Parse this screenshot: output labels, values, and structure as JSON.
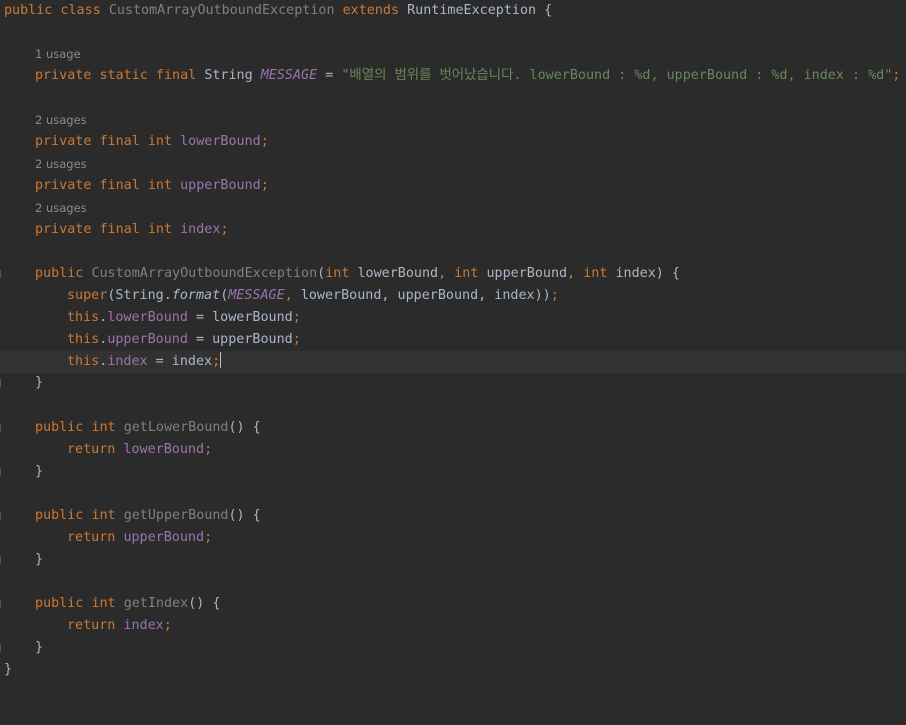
{
  "editor": {
    "inlay_hints": {
      "message": "1 usage",
      "lower": "2 usages",
      "upper": "2 usages",
      "index": "2 usages"
    },
    "code": {
      "l_class_public": "public class ",
      "l_class_name": "CustomArrayOutboundException ",
      "l_class_extends": "extends ",
      "l_class_super": "RuntimeException {",
      "l_msg_mods": "private static final ",
      "l_msg_type": "String ",
      "l_msg_name": "MESSAGE",
      "l_msg_eq": " = ",
      "l_msg_value": "\"배열의 범위를 벗어났습니다. lowerBound : %d, upperBound : %d, index : %d\"",
      "l_msg_semi": ";",
      "l_lb_mods": "private final int ",
      "l_lb_name": "lowerBound",
      "l_ub_mods": "private final int ",
      "l_ub_name": "upperBound",
      "l_ix_mods": "private final int ",
      "l_ix_name": "index",
      "semi": ";",
      "ctor_public": "public ",
      "ctor_name": "CustomArrayOutboundException",
      "ctor_open": "(",
      "ctor_int1": "int ",
      "ctor_p1": "lowerBound",
      "ctor_comma1": ", ",
      "ctor_int2": "int ",
      "ctor_p2": "upperBound",
      "ctor_comma2": ", ",
      "ctor_int3": "int ",
      "ctor_p3": "index",
      "ctor_close": ") {",
      "super_kw": "super",
      "super_a": "(String.",
      "super_format": "format",
      "super_b": "(",
      "super_msg": "MESSAGE",
      "super_c1": ", ",
      "super_args": "lowerBound, upperBound, index",
      "super_d": "))",
      "this_kw": "this",
      "dot": ".",
      "assign_lb_field": "lowerBound",
      "assign_lb_rhs": " = lowerBound",
      "assign_ub_field": "upperBound",
      "assign_ub_rhs": " = upperBound",
      "assign_ix_field": "index",
      "assign_ix_rhs": " = index",
      "close_brace": "}",
      "get_public": "public ",
      "get_int": "int ",
      "get_lb_name": "getLowerBound",
      "get_ub_name": "getUpperBound",
      "get_ix_name": "getIndex",
      "get_sig_tail": "() {",
      "return_kw": "return ",
      "ret_lb": "lowerBound",
      "ret_ub": "upperBound",
      "ret_ix": "index"
    }
  }
}
